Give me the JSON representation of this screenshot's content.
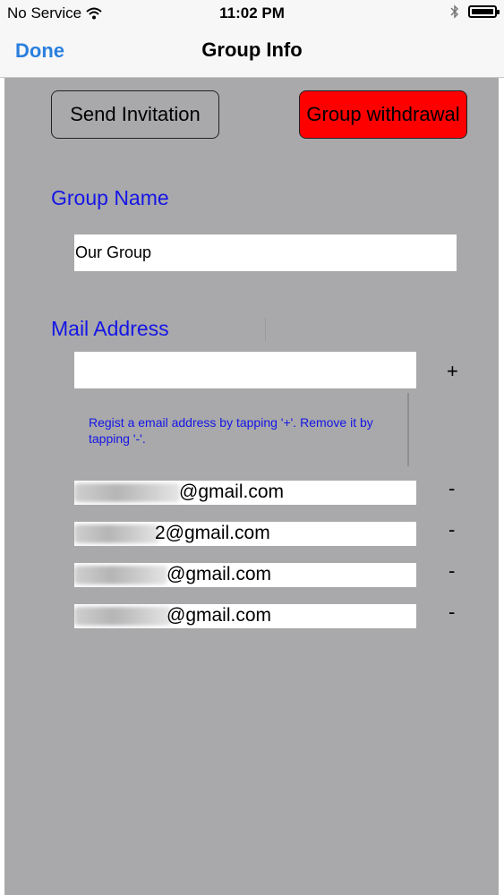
{
  "status_bar": {
    "carrier": "No Service",
    "time": "11:02 PM",
    "icons": [
      "wifi-icon",
      "bluetooth-icon",
      "battery-icon"
    ]
  },
  "nav": {
    "done_label": "Done",
    "title": "Group Info"
  },
  "buttons": {
    "send_invitation": "Send Invitation",
    "group_withdrawal": "Group withdrawal"
  },
  "group_name": {
    "label": "Group Name",
    "value": "Our Group"
  },
  "mail": {
    "label": "Mail Address",
    "input_value": "",
    "add_label": "+",
    "hint": "Regist a email address by tapping '+'. Remove it by tapping '-'.",
    "addresses": [
      {
        "visible_suffix": "@gmail.com",
        "remove_label": "-"
      },
      {
        "visible_suffix": "2@gmail.com",
        "remove_label": "-"
      },
      {
        "visible_suffix": "@gmail.com",
        "remove_label": "-"
      },
      {
        "visible_suffix": "@gmail.com",
        "remove_label": "-"
      }
    ]
  },
  "colors": {
    "accent_blue": "#2a7fde",
    "label_blue": "#1515e6",
    "withdraw_red": "#ff0000",
    "content_gray": "#a9a9ab"
  }
}
